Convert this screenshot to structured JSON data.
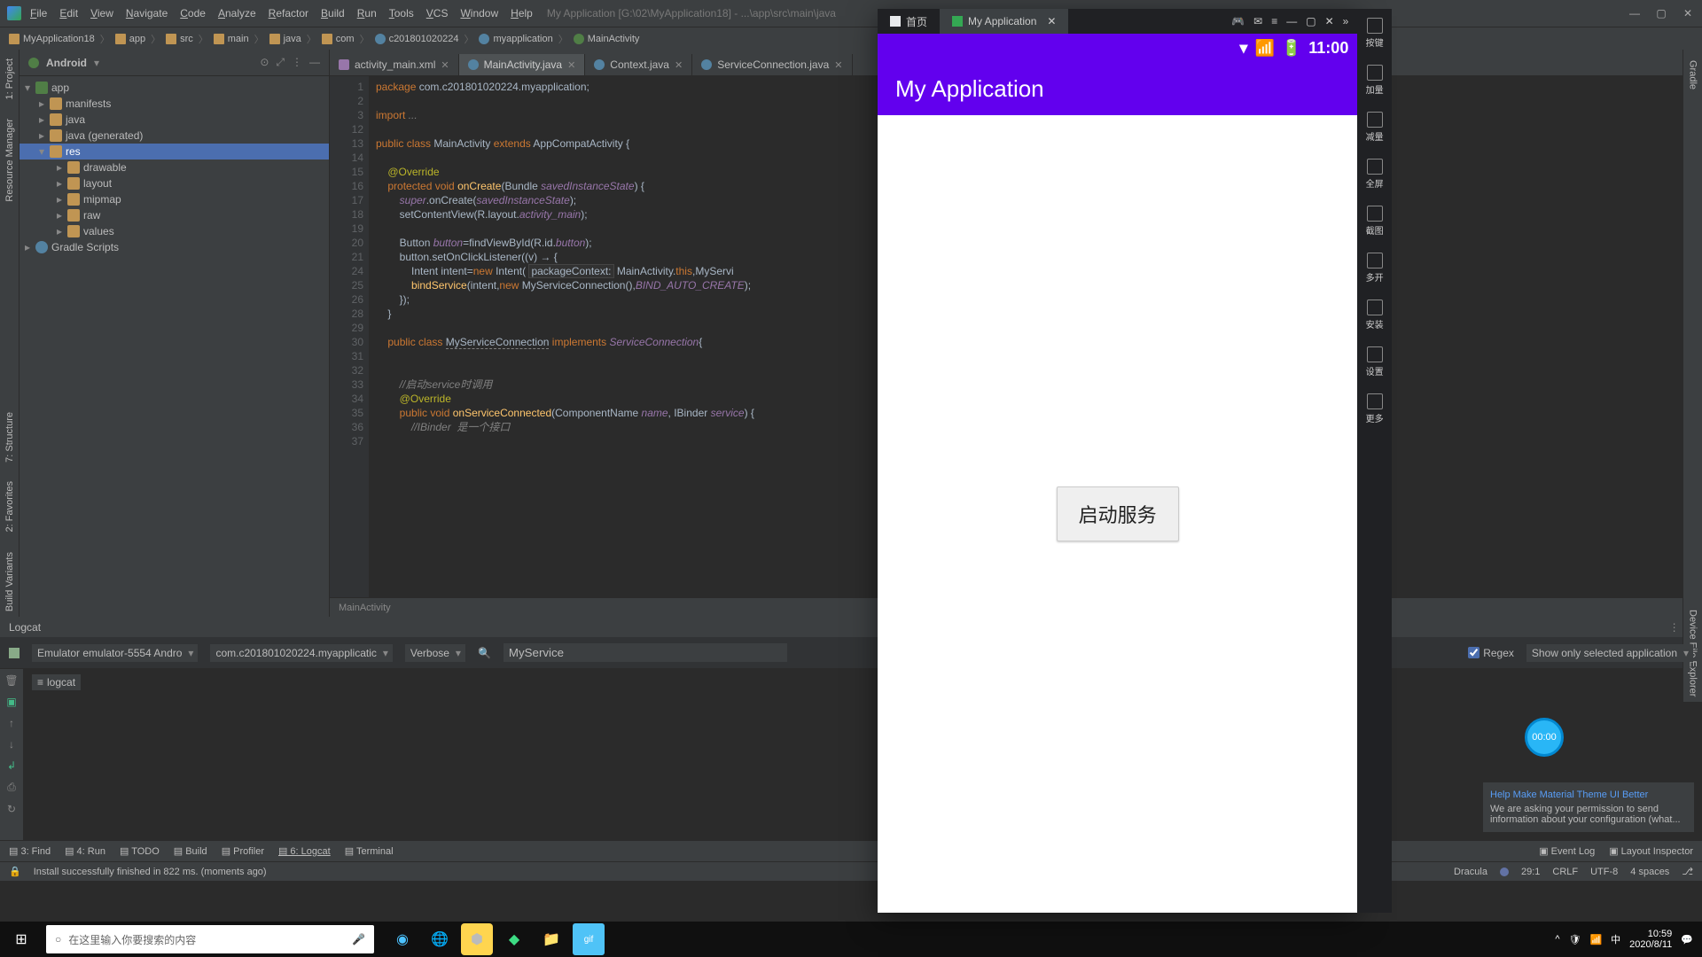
{
  "titlebar": {
    "menus": [
      "File",
      "Edit",
      "View",
      "Navigate",
      "Code",
      "Analyze",
      "Refactor",
      "Build",
      "Run",
      "Tools",
      "VCS",
      "Window",
      "Help"
    ],
    "app_title": "My Application [G:\\02\\MyApplication18] - ...\\app\\src\\main\\java"
  },
  "breadcrumb": [
    "MyApplication18",
    "app",
    "src",
    "main",
    "java",
    "com",
    "c201801020224",
    "myapplication",
    "MainActivity"
  ],
  "project": {
    "title": "Android",
    "tree": [
      {
        "l": 0,
        "tw": "▾",
        "icon": "fi-app",
        "label": "app"
      },
      {
        "l": 1,
        "tw": "▸",
        "icon": "fi-folder",
        "label": "manifests"
      },
      {
        "l": 1,
        "tw": "▸",
        "icon": "fi-folder",
        "label": "java"
      },
      {
        "l": 1,
        "tw": "▸",
        "icon": "fi-folder",
        "label": "java (generated)"
      },
      {
        "l": 1,
        "tw": "▾",
        "icon": "fi-folder",
        "label": "res",
        "sel": true
      },
      {
        "l": 2,
        "tw": "▸",
        "icon": "fi-folder",
        "label": "drawable"
      },
      {
        "l": 2,
        "tw": "▸",
        "icon": "fi-folder",
        "label": "layout"
      },
      {
        "l": 2,
        "tw": "▸",
        "icon": "fi-folder",
        "label": "mipmap"
      },
      {
        "l": 2,
        "tw": "▸",
        "icon": "fi-folder",
        "label": "raw"
      },
      {
        "l": 2,
        "tw": "▸",
        "icon": "fi-folder",
        "label": "values"
      },
      {
        "l": 0,
        "tw": "▸",
        "icon": "fi-dot",
        "label": "Gradle Scripts"
      }
    ]
  },
  "tabs": [
    {
      "icon": "xml",
      "label": "activity_main.xml",
      "active": false
    },
    {
      "icon": "java",
      "label": "MainActivity.java",
      "active": true
    },
    {
      "icon": "java",
      "label": "Context.java",
      "active": false
    },
    {
      "icon": "java",
      "label": "ServiceConnection.java",
      "active": false
    }
  ],
  "code_lines": [
    {
      "n": 1,
      "html": "<span class='kw'>package</span> com.c201801020224.myapplication;"
    },
    {
      "n": 2,
      "html": ""
    },
    {
      "n": 3,
      "html": "<span class='kw'>import</span> <span class='cmt'>...</span>"
    },
    {
      "n": 12,
      "html": ""
    },
    {
      "n": 13,
      "html": "<span class='kw'>public class</span> MainActivity <span class='kw'>extends</span> AppCompatActivity {",
      "mark": true
    },
    {
      "n": 14,
      "html": ""
    },
    {
      "n": 15,
      "html": "    <span class='ann'>@Override</span>"
    },
    {
      "n": 16,
      "html": "    <span class='kw'>protected void</span> <span class='fn'>onCreate</span>(Bundle <span class='fld'>savedInstanceState</span>) {",
      "mark": true
    },
    {
      "n": 17,
      "html": "        <span class='fld'>super</span>.onCreate(<span class='fld'>savedInstanceState</span>);"
    },
    {
      "n": 18,
      "html": "        setContentView(R.layout.<span class='fld'>activity_main</span>);"
    },
    {
      "n": 19,
      "html": ""
    },
    {
      "n": 20,
      "html": "        Button <span class='fld'>button</span>=findViewById(R.id.<span class='fld'>button</span>);"
    },
    {
      "n": 21,
      "html": "        button.setOnClickListener((v) → {",
      "mark": true
    },
    {
      "n": 24,
      "html": "            Intent intent=<span class='kw'>new</span> Intent( <span class='bg-hl'>packageContext:</span> MainActivity.<span class='kw'>this</span>,MyServi"
    },
    {
      "n": 25,
      "html": "            <span class='fn'>bindService</span>(intent,<span class='kw'>new</span> MyServiceConnection(),<span class='fld'>BIND_AUTO_CREATE</span>);"
    },
    {
      "n": 26,
      "html": "        });"
    },
    {
      "n": 28,
      "html": "    }"
    },
    {
      "n": 29,
      "html": "",
      "caret": true
    },
    {
      "n": 30,
      "html": "    <span class='kw'>public class</span> <span style='border-bottom:1px dashed #808080'>MyServiceConnection</span> <span class='kw'>implements</span> <span class='fld'>ServiceConnection</span>{"
    },
    {
      "n": 31,
      "html": ""
    },
    {
      "n": 32,
      "html": ""
    },
    {
      "n": 33,
      "html": "        <span class='cmt'>//启动service时调用</span>"
    },
    {
      "n": 34,
      "html": "        <span class='ann'>@Override</span>"
    },
    {
      "n": 35,
      "html": "        <span class='kw'>public void</span> <span class='fn'>onServiceConnected</span>(ComponentName <span class='fld'>name</span>, IBinder <span class='fld'>service</span>) {",
      "mark": true
    },
    {
      "n": 36,
      "html": "            <span class='cmt'>//IBinder  是一个接口</span>"
    },
    {
      "n": 37,
      "html": ""
    }
  ],
  "crumb_bottom": "MainActivity",
  "logcat": {
    "title": "Logcat",
    "device": "Emulator emulator-5554 Andro",
    "process": "com.c201801020224.myapplicatic",
    "level": "Verbose",
    "filter": "MyService",
    "regex_label": "Regex",
    "scope": "Show only selected application",
    "tab_chip": "logcat"
  },
  "notif": {
    "title": "Help Make Material Theme UI Better",
    "body": "We are asking your permission to send information about your configuration (what..."
  },
  "bottom_items": [
    "3: Find",
    "4: Run",
    "TODO",
    "Build",
    "Profiler",
    "6: Logcat",
    "Terminal"
  ],
  "bottom_right": [
    "Event Log",
    "Layout Inspector"
  ],
  "status": {
    "msg": "Install successfully finished in 822 ms. (moments ago)",
    "theme": "Dracula",
    "pos": "29:1",
    "eol": "CRLF",
    "enc": "UTF-8",
    "indent": "4 spaces"
  },
  "left_tools": [
    "1: Project",
    "Resource Manager"
  ],
  "left_tools2": [
    "2: Favorites",
    "Build Variants",
    "7: Structure"
  ],
  "right_tools": [
    "Gradle",
    "Device File Explorer"
  ],
  "taskbar": {
    "search_placeholder": "在这里输入你要搜索的内容",
    "time": "10:59",
    "date": "2020/8/11"
  },
  "emulator": {
    "tab_home": "首页",
    "tab_app": "My Application",
    "time": "11:00",
    "app_title": "My Application",
    "button_label": "启动服务",
    "side": [
      "按键",
      "加量",
      "减量",
      "全屏",
      "截图",
      "多开",
      "安装",
      "设置",
      "更多"
    ]
  },
  "record_time": "00:00"
}
